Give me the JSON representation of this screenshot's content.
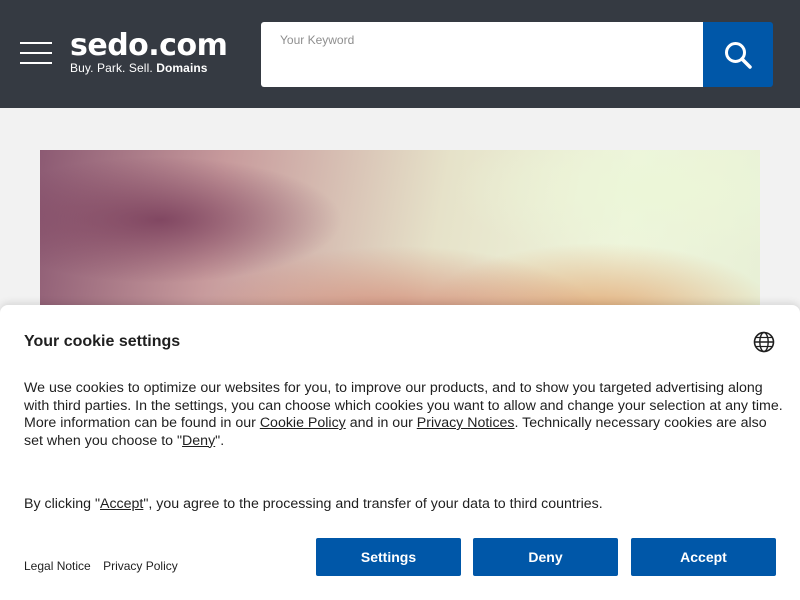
{
  "header": {
    "logo_main": "sedo.com",
    "logo_sub_parts": [
      "Buy.",
      "Park.",
      "Sell."
    ],
    "logo_sub_strong": "Domains",
    "search_placeholder": "Your Keyword"
  },
  "colors": {
    "topbar": "#353a42",
    "accent": "#0057a8"
  },
  "cookie": {
    "title": "Your cookie settings",
    "text_part1": "We use cookies to optimize our websites for you, to improve our products, and to show you targeted advertising along with third parties. In the settings, you can choose which cookies you want to allow and change your selection at any time. More information can be found in our ",
    "cookie_policy_link": "Cookie Policy",
    "text_part2": " and in our ",
    "privacy_notices_link": "Privacy Notices",
    "text_part3": ". Technically necessary cookies are also set when you choose to \"",
    "deny_link": "Deny",
    "text_part4": "\".",
    "text2_part1": "By clicking \"",
    "accept_link": "Accept",
    "text2_part2": "\", you agree to the processing and transfer of your data to third countries.",
    "legal_notice": "Legal Notice",
    "privacy_policy": "Privacy Policy",
    "buttons": {
      "settings": "Settings",
      "deny": "Deny",
      "accept": "Accept"
    }
  }
}
